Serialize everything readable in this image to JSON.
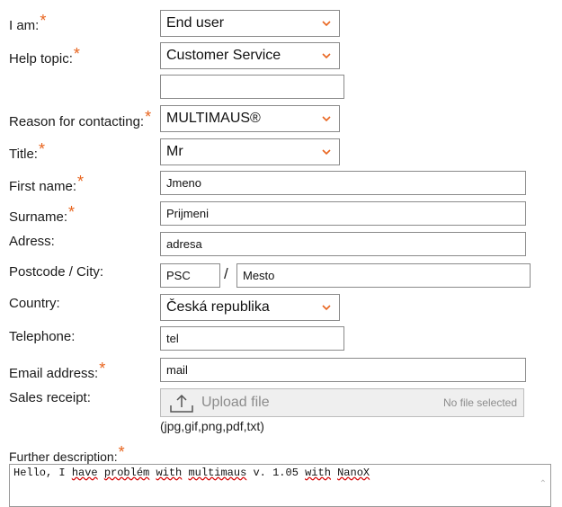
{
  "form": {
    "i_am": {
      "label": "I am:",
      "required": "*",
      "value": "End user"
    },
    "help_topic": {
      "label": "Help topic:",
      "required": "*",
      "value": "Customer Service",
      "extra_value": ""
    },
    "reason": {
      "label": "Reason for contacting:",
      "required": "*",
      "value": "MULTIMAUS®"
    },
    "title": {
      "label": "Title:",
      "required": "*",
      "value": "Mr"
    },
    "first_name": {
      "label": "First name:",
      "required": "*",
      "value": "Jmeno"
    },
    "surname": {
      "label": "Surname:",
      "required": "*",
      "value": "Prijmeni"
    },
    "address": {
      "label": "Adress:",
      "value": "adresa"
    },
    "postcode_city": {
      "label": "Postcode / City:",
      "postcode": "PSC",
      "separator": "/",
      "city": "Mesto"
    },
    "country": {
      "label": "Country:",
      "value": "Česká republika"
    },
    "telephone": {
      "label": "Telephone:",
      "value": "tel"
    },
    "email": {
      "label": "Email address:",
      "required": "*",
      "value": "mail"
    },
    "sales_receipt": {
      "label": "Sales receipt:",
      "upload_label": "Upload file",
      "status": "No file selected",
      "hint": "(jpg,gif,png,pdf,txt)",
      "icon": "upload-icon"
    },
    "description": {
      "label": "Further description:",
      "required": "*",
      "text": {
        "w1": "Hello, I ",
        "w2": "have",
        "w3": " ",
        "w4": "problém",
        "w5": " ",
        "w6": "with",
        "w7": " ",
        "w8": "multimaus",
        "w9": " v. 1.05 ",
        "w10": "with",
        "w11": " ",
        "w12": "NanoX"
      }
    }
  },
  "colors": {
    "required": "#e8641e",
    "border": "#8a8a8a",
    "chevron": "#e8641e"
  }
}
